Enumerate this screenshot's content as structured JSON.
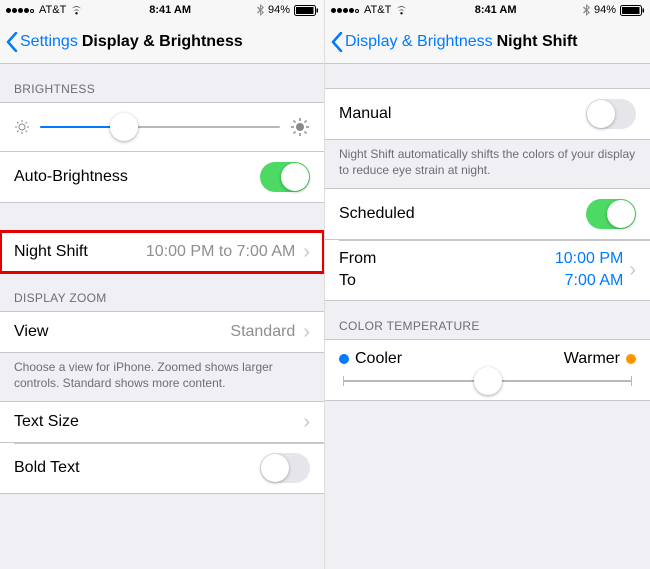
{
  "status": {
    "carrier": "AT&T",
    "time": "8:41 AM",
    "battery": "94%"
  },
  "screen1": {
    "back_label": "Settings",
    "title": "Display & Brightness",
    "sections": {
      "brightness_header": "BRIGHTNESS",
      "auto_brightness": "Auto-Brightness",
      "night_shift": "Night Shift",
      "night_shift_detail": "10:00 PM to 7:00 AM",
      "display_zoom_header": "DISPLAY ZOOM",
      "view": "View",
      "view_value": "Standard",
      "zoom_footer": "Choose a view for iPhone. Zoomed shows larger controls. Standard shows more content.",
      "text_size": "Text Size",
      "bold_text": "Bold Text"
    }
  },
  "screen2": {
    "back_label": "Display & Brightness",
    "title": "Night Shift",
    "sections": {
      "manual": "Manual",
      "description": "Night Shift automatically shifts the colors of your display to reduce eye strain at night.",
      "scheduled": "Scheduled",
      "from": "From",
      "to": "To",
      "from_value": "10:00 PM",
      "to_value": "7:00 AM",
      "color_temp_header": "COLOR TEMPERATURE",
      "cooler": "Cooler",
      "warmer": "Warmer"
    }
  }
}
